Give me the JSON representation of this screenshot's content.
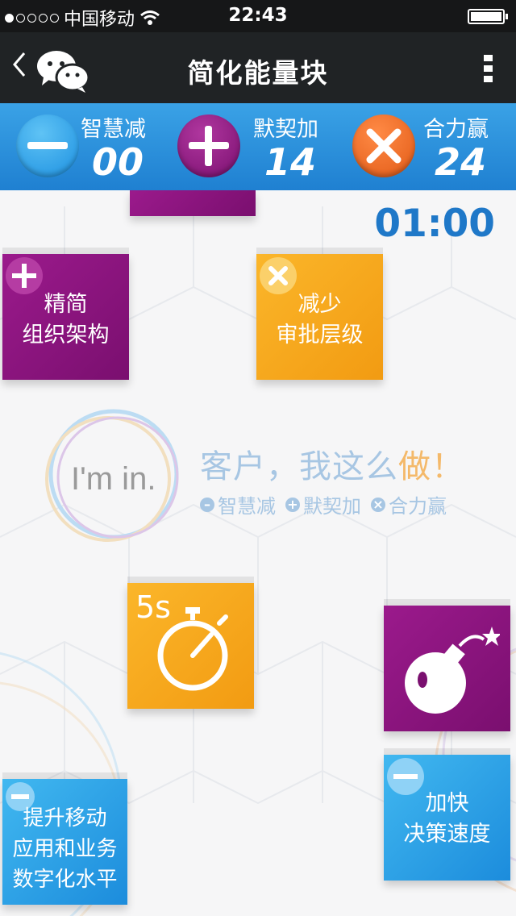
{
  "status_bar": {
    "carrier": "中国移动",
    "time": "22:43"
  },
  "nav": {
    "title": "简化能量块"
  },
  "scores": [
    {
      "label": "智慧减",
      "value": "00",
      "icon": "minus-icon",
      "color": "#29a3ea"
    },
    {
      "label": "默契加",
      "value": "14",
      "icon": "plus-icon",
      "color": "#8e1c80"
    },
    {
      "label": "合力赢",
      "value": "24",
      "icon": "x-icon",
      "color": "#ef6c22"
    }
  ],
  "timer": "01:00",
  "brand": {
    "logo_text": "I'm in.",
    "slogan_main": "客户，我这么",
    "slogan_highlight": "做！",
    "legend": [
      "智慧减",
      "默契加",
      "合力赢"
    ]
  },
  "tiles": {
    "t1": {
      "text": "精简\n组织架构",
      "badge": "plus-icon"
    },
    "t2": {
      "text": "减少\n审批层级",
      "badge": "x-icon"
    },
    "t3": {
      "label": "5s",
      "icon": "stopwatch-icon"
    },
    "t4": {
      "icon": "bomb-icon"
    },
    "t5": {
      "text": "提升移动\n应用和业务\n数字化水平",
      "badge": "minus-icon"
    },
    "t6": {
      "text": "加快\n决策速度",
      "badge": "minus-icon"
    }
  }
}
